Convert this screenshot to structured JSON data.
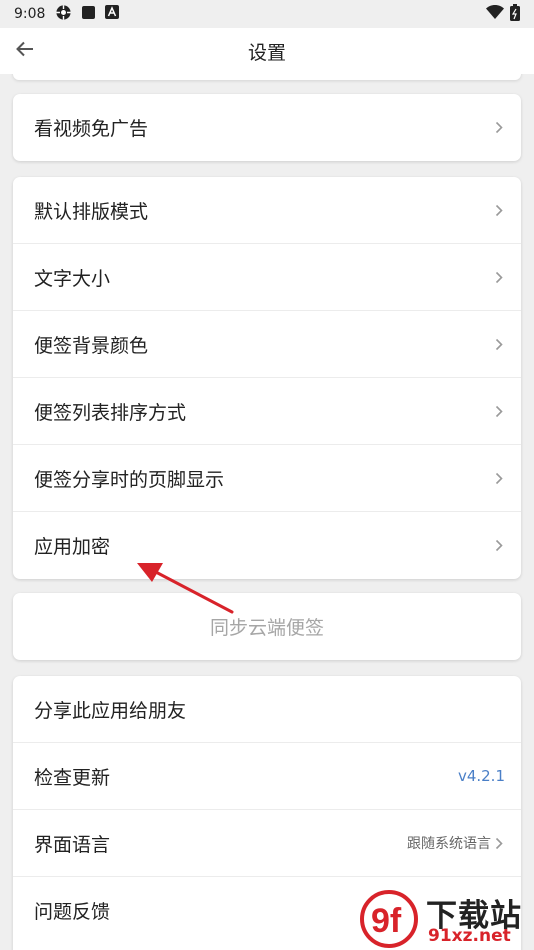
{
  "status_bar": {
    "time": "9:08",
    "icons": [
      "settings-gear-icon",
      "stop-square-icon",
      "font-a-icon"
    ],
    "right_icons": [
      "wifi-icon",
      "battery-icon"
    ]
  },
  "header": {
    "title": "设置",
    "back_icon": "arrow-left-icon"
  },
  "groups": [
    {
      "id": "ads",
      "items": [
        {
          "label": "看视频免广告",
          "value": ""
        }
      ]
    },
    {
      "id": "display",
      "items": [
        {
          "label": "默认排版模式",
          "value": ""
        },
        {
          "label": "文字大小",
          "value": ""
        },
        {
          "label": "便签背景颜色",
          "value": ""
        },
        {
          "label": "便签列表排序方式",
          "value": ""
        },
        {
          "label": "便签分享时的页脚显示",
          "value": ""
        },
        {
          "label": "应用加密",
          "value": ""
        }
      ]
    },
    {
      "id": "sync",
      "items": [
        {
          "label": "同步云端便签",
          "value": ""
        }
      ]
    },
    {
      "id": "about",
      "items": [
        {
          "label": "分享此应用给朋友",
          "value": ""
        },
        {
          "label": "检查更新",
          "value": "v4.2.1"
        },
        {
          "label": "界面语言",
          "value": "跟随系统语言"
        },
        {
          "label": "问题反馈",
          "value": ""
        }
      ]
    }
  ],
  "annotation": {
    "type": "red-arrow",
    "color": "#d8232a",
    "points_to": "应用加密"
  },
  "watermark": {
    "logo": "9f-logo",
    "text_top": "下载站",
    "text_bottom": "91xz.net"
  },
  "colors": {
    "background": "#efefef",
    "card": "#ffffff",
    "version": "#4a7fc7",
    "sync_text": "#a6a6a6",
    "annotation": "#d8232a"
  }
}
